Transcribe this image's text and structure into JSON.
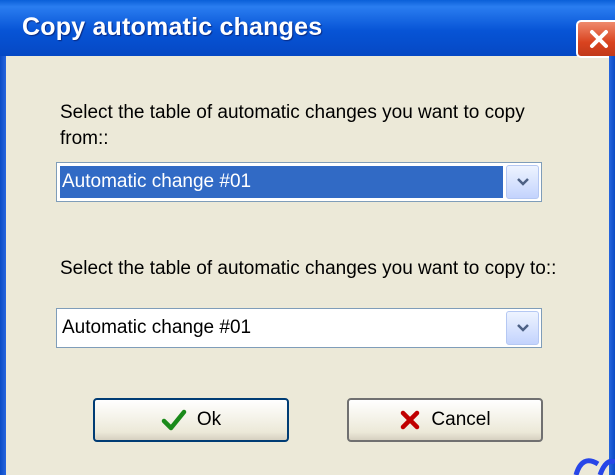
{
  "window": {
    "title": "Copy automatic changes",
    "close_icon": "close-icon"
  },
  "source": {
    "label": "Select the table of automatic changes you want to copy from::",
    "selected_value": "Automatic change #01"
  },
  "destination": {
    "label": "Select the table of automatic changes you want to copy to::",
    "selected_value": "Automatic change #01"
  },
  "buttons": {
    "ok_label": "Ok",
    "ok_icon": "checkmark-icon",
    "cancel_label": "Cancel",
    "cancel_icon": "x-icon"
  },
  "colors": {
    "titlebar": "#0754d6",
    "selection": "#316ac5",
    "close": "#d9431f",
    "ok_check": "#1a8a1a",
    "cancel_x": "#c00000"
  }
}
